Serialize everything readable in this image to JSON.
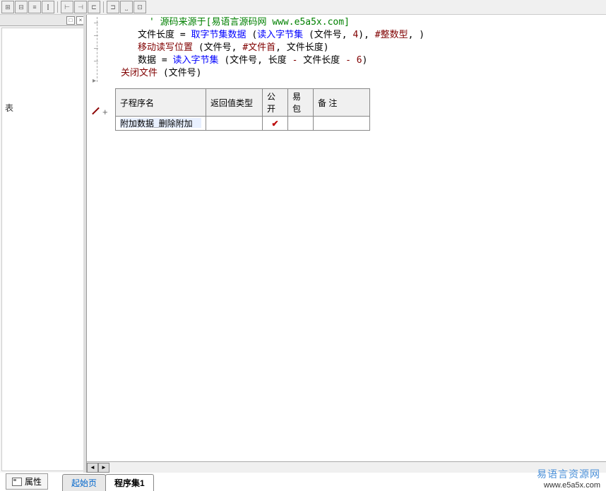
{
  "toolbar_icons": [
    "⊞",
    "⊟",
    "≡",
    "⫿",
    "⊢",
    "⊣",
    "⊏",
    "⊐",
    "⎵",
    "⎿",
    "⊡"
  ],
  "left_panel": {
    "close_label": "×",
    "pin_label": "□",
    "content_char": "表"
  },
  "code": {
    "line1_prefix": "' ",
    "line1_text": "源码来源于[易语言源码网 ",
    "line1_url": "www.e5a5x.com",
    "line1_suffix": "]",
    "line2_a": "文件长度 ",
    "line2_eq": "= ",
    "line2_fn": "取字节集数据 ",
    "line2_paren_open": "(",
    "line2_arg1": "读入字节集 ",
    "line2_paren2": "(文件号, ",
    "line2_num": "4",
    "line2_paren2c": "), ",
    "line2_const": "#整数型",
    "line2_end": ", )",
    "line3_fn": "移动读写位置 ",
    "line3_args": "(文件号, ",
    "line3_const": "#文件首",
    "line3_args2": ", 文件长度)",
    "line4_a": "数据 ",
    "line4_eq": "= ",
    "line4_fn": "读入字节集 ",
    "line4_args": "(文件号, 长度 ",
    "line4_minus": "- ",
    "line4_args2": "文件长度 ",
    "line4_minus2": "- ",
    "line4_num": "6",
    "line4_end": ")",
    "line5_fn": "关闭文件 ",
    "line5_args": "(文件号)"
  },
  "table": {
    "headers": {
      "col1": "子程序名",
      "col2": "返回值类型",
      "col3": "公开",
      "col4": "易包",
      "col5": "备 注"
    },
    "row1": {
      "name": "附加数据_删除附加",
      "return_type": "",
      "public": "✔",
      "yibao": "",
      "remark": ""
    }
  },
  "plus_symbol": "+",
  "scroll": {
    "left": "◄",
    "right": "►"
  },
  "bottom": {
    "properties": "属性",
    "tab_start": "起始页",
    "tab_program": "程序集1"
  },
  "watermark": {
    "title": "易语言资源网",
    "url": "www.e5a5x.com"
  }
}
